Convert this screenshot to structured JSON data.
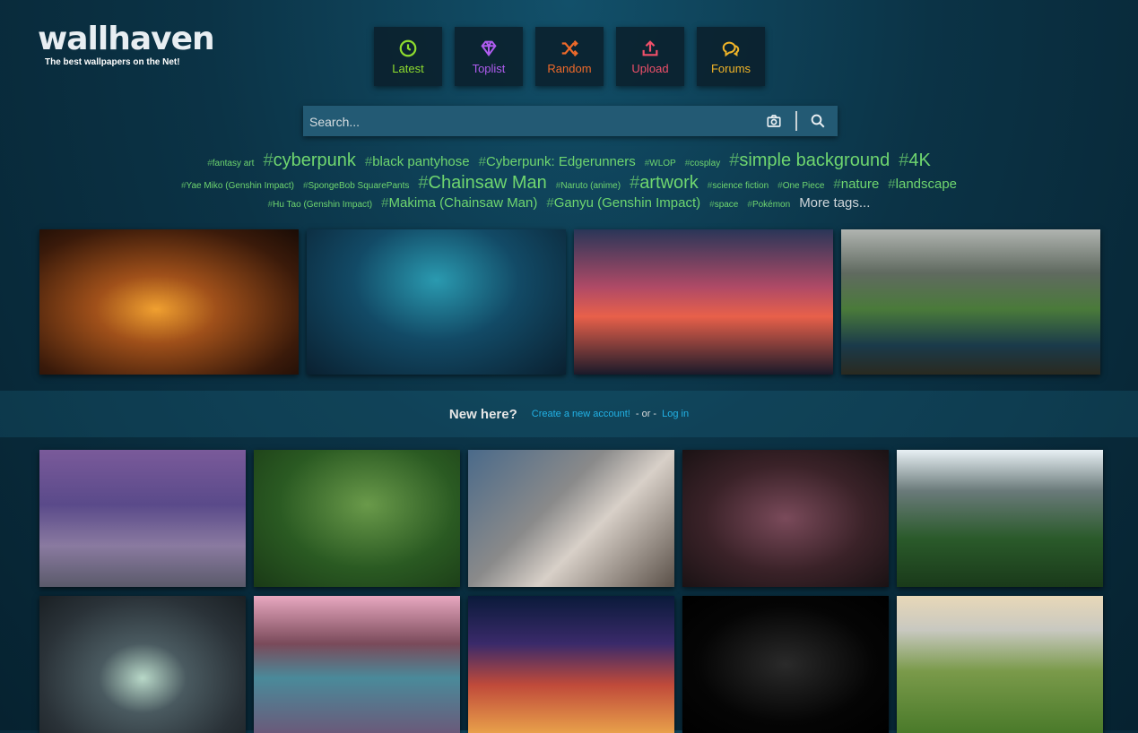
{
  "logo": {
    "text": "wallhaven",
    "tagline": "The best wallpapers on the Net!"
  },
  "nav": [
    {
      "label": "Latest",
      "color": "#8edc2e",
      "icon": "clock-icon"
    },
    {
      "label": "Toplist",
      "color": "#b05cf0",
      "icon": "diamond-icon"
    },
    {
      "label": "Random",
      "color": "#f06a2a",
      "icon": "shuffle-icon"
    },
    {
      "label": "Upload",
      "color": "#f0506a",
      "icon": "upload-icon"
    },
    {
      "label": "Forums",
      "color": "#f0b428",
      "icon": "chat-icon"
    }
  ],
  "search": {
    "placeholder": "Search..."
  },
  "tags": {
    "row1": [
      "fantasy art",
      "cyberpunk",
      "black pantyhose",
      "Cyberpunk: Edgerunners",
      "WLOP",
      "cosplay",
      "simple background",
      "4K"
    ],
    "row2": [
      "Yae Miko (Genshin Impact)",
      "SpongeBob SquarePants",
      "Chainsaw Man",
      "Naruto (anime)",
      "artwork",
      "science fiction",
      "One Piece",
      "nature",
      "landscape"
    ],
    "row3": [
      "Hu Tao (Genshin Impact)",
      "Makima (Chainsaw Man)",
      "Ganyu (Genshin Impact)",
      "space",
      "Pokémon"
    ],
    "more": "More tags..."
  },
  "signup": {
    "question": "New here?",
    "create": "Create a new account!",
    "or": "- or -",
    "login": "Log in"
  }
}
